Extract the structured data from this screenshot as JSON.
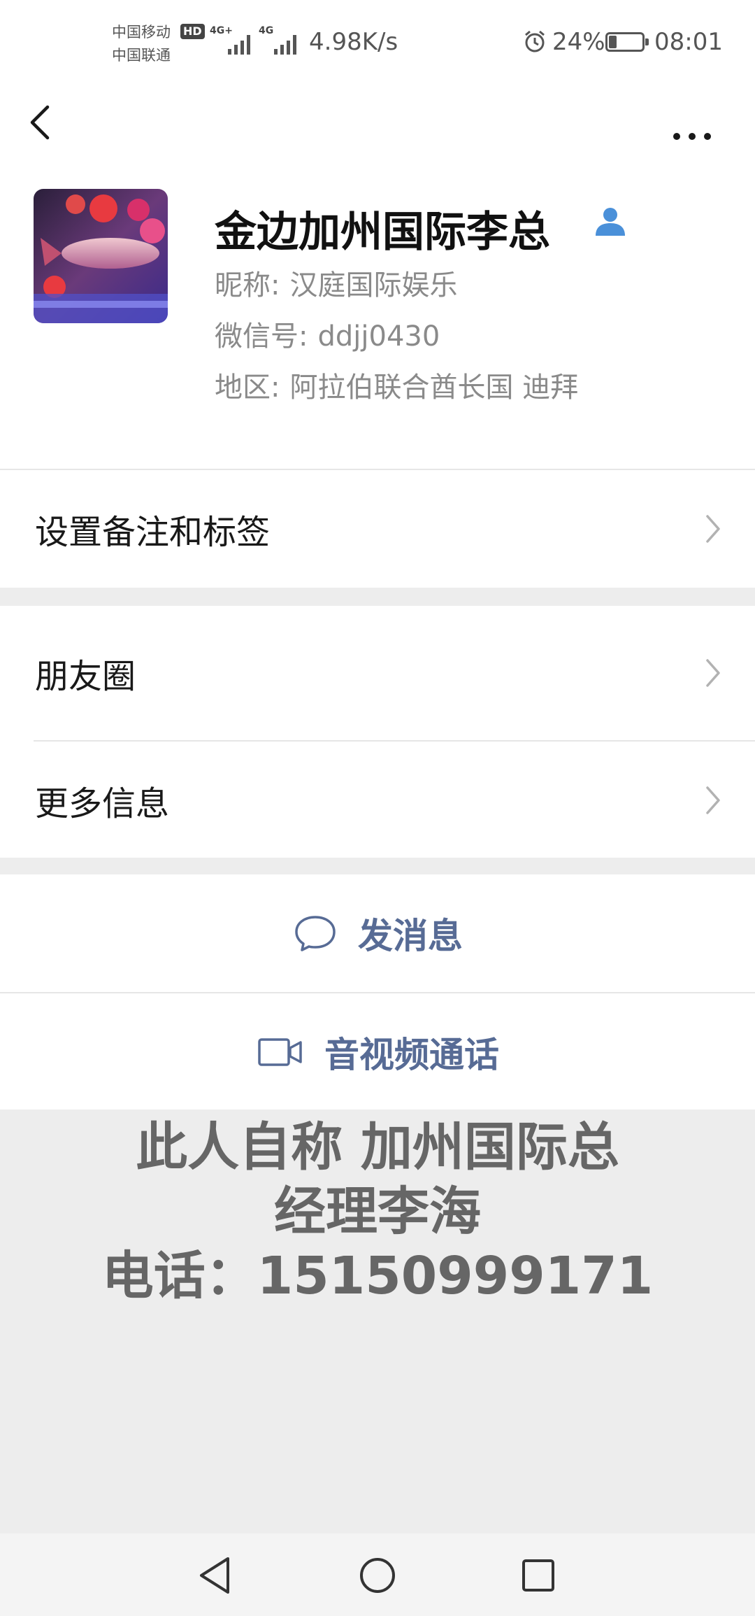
{
  "status_bar": {
    "carrier_1": "中国移动",
    "carrier_2": "中国联通",
    "hd_badge": "HD",
    "network_1": "4G+",
    "network_2": "4G",
    "speed": "4.98K/s",
    "battery": "24%",
    "time": "08:01",
    "battery_level_fraction": 0.24
  },
  "top_bar": {
    "back_icon": "chevron-left-icon",
    "more_icon": "more-dots-icon"
  },
  "profile": {
    "display_name": "金边加州国际李总",
    "nickname_label": "昵称:",
    "nickname": "汉庭国际娱乐",
    "wechat_id_label": "微信号:",
    "wechat_id": "ddjj0430",
    "region_label": "地区:",
    "region": "阿拉伯联合酋长国  迪拜",
    "contact_icon": "contact-person-icon"
  },
  "menu": {
    "remark_tags": "设置备注和标签",
    "moments": "朋友圈",
    "more_info": "更多信息"
  },
  "actions": {
    "send_message": "发消息",
    "av_call": "音视频通话"
  },
  "overlay": {
    "line_1": "此人自称 加州国际总",
    "line_2": "经理李海",
    "line_3": "电话：15150999171"
  },
  "colors": {
    "link_blue": "#576b95",
    "background_gray": "#ededed",
    "contact_icon_blue": "#4a90d9"
  }
}
